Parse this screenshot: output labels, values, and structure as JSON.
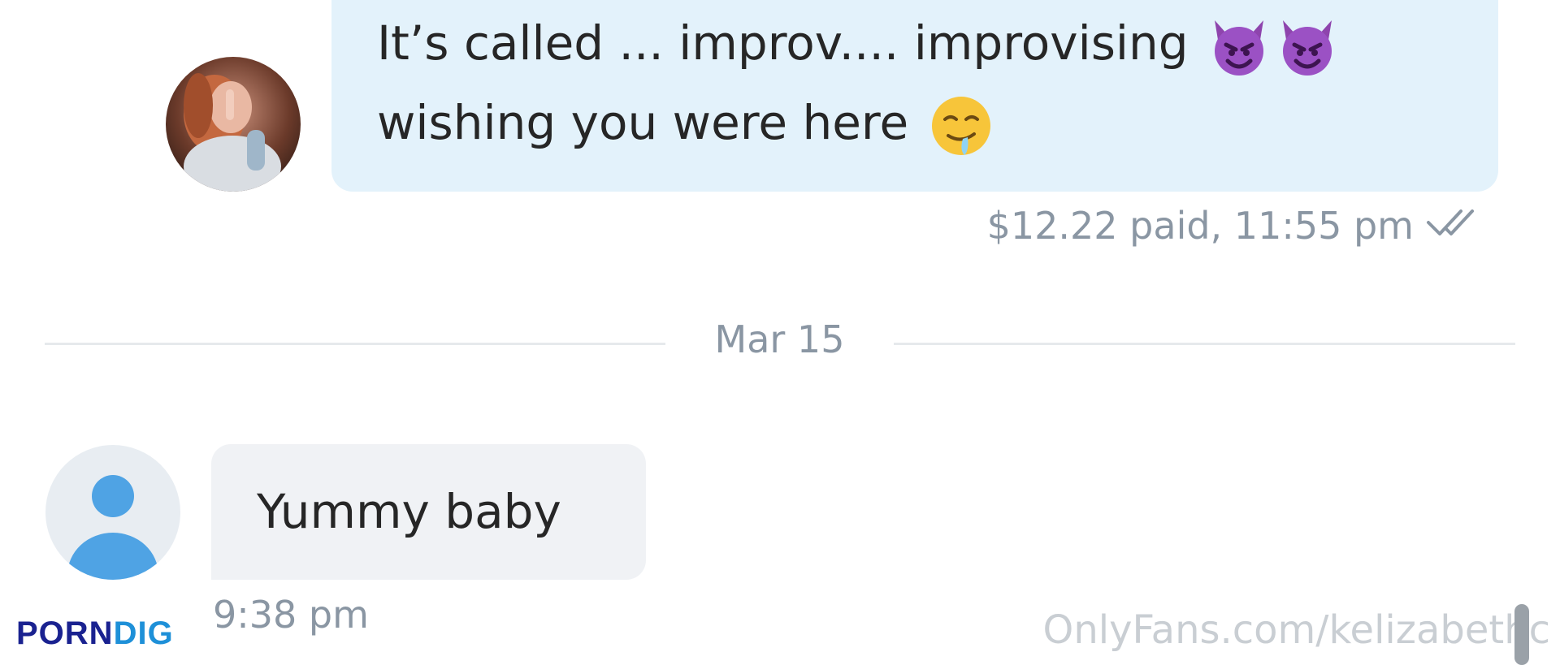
{
  "conversation": {
    "outgoing_message": {
      "line1": "It’s called ... improv.... improvising",
      "line2": "wishing you were here",
      "line1_emojis": [
        "smiling-imp",
        "smiling-imp"
      ],
      "line2_emoji": "drooling-face",
      "meta": "$12.22 paid, 11:55 pm",
      "status_icon": "double-check-icon"
    },
    "date_divider": "Mar 15",
    "incoming_message": {
      "text": "Yummy baby",
      "time": "9:38 pm"
    }
  },
  "watermarks": {
    "left_part1": "PORN",
    "left_part2": "DIG",
    "right": "OnlyFans.com/kelizabethc"
  },
  "colors": {
    "outgoing_bubble": "#e3f2fb",
    "incoming_bubble": "#f0f2f5",
    "meta_text": "#8a96a3",
    "placeholder_avatar": "#4fa3e4",
    "porn_blue": "#1a2290",
    "dig_blue": "#1e90d8"
  }
}
